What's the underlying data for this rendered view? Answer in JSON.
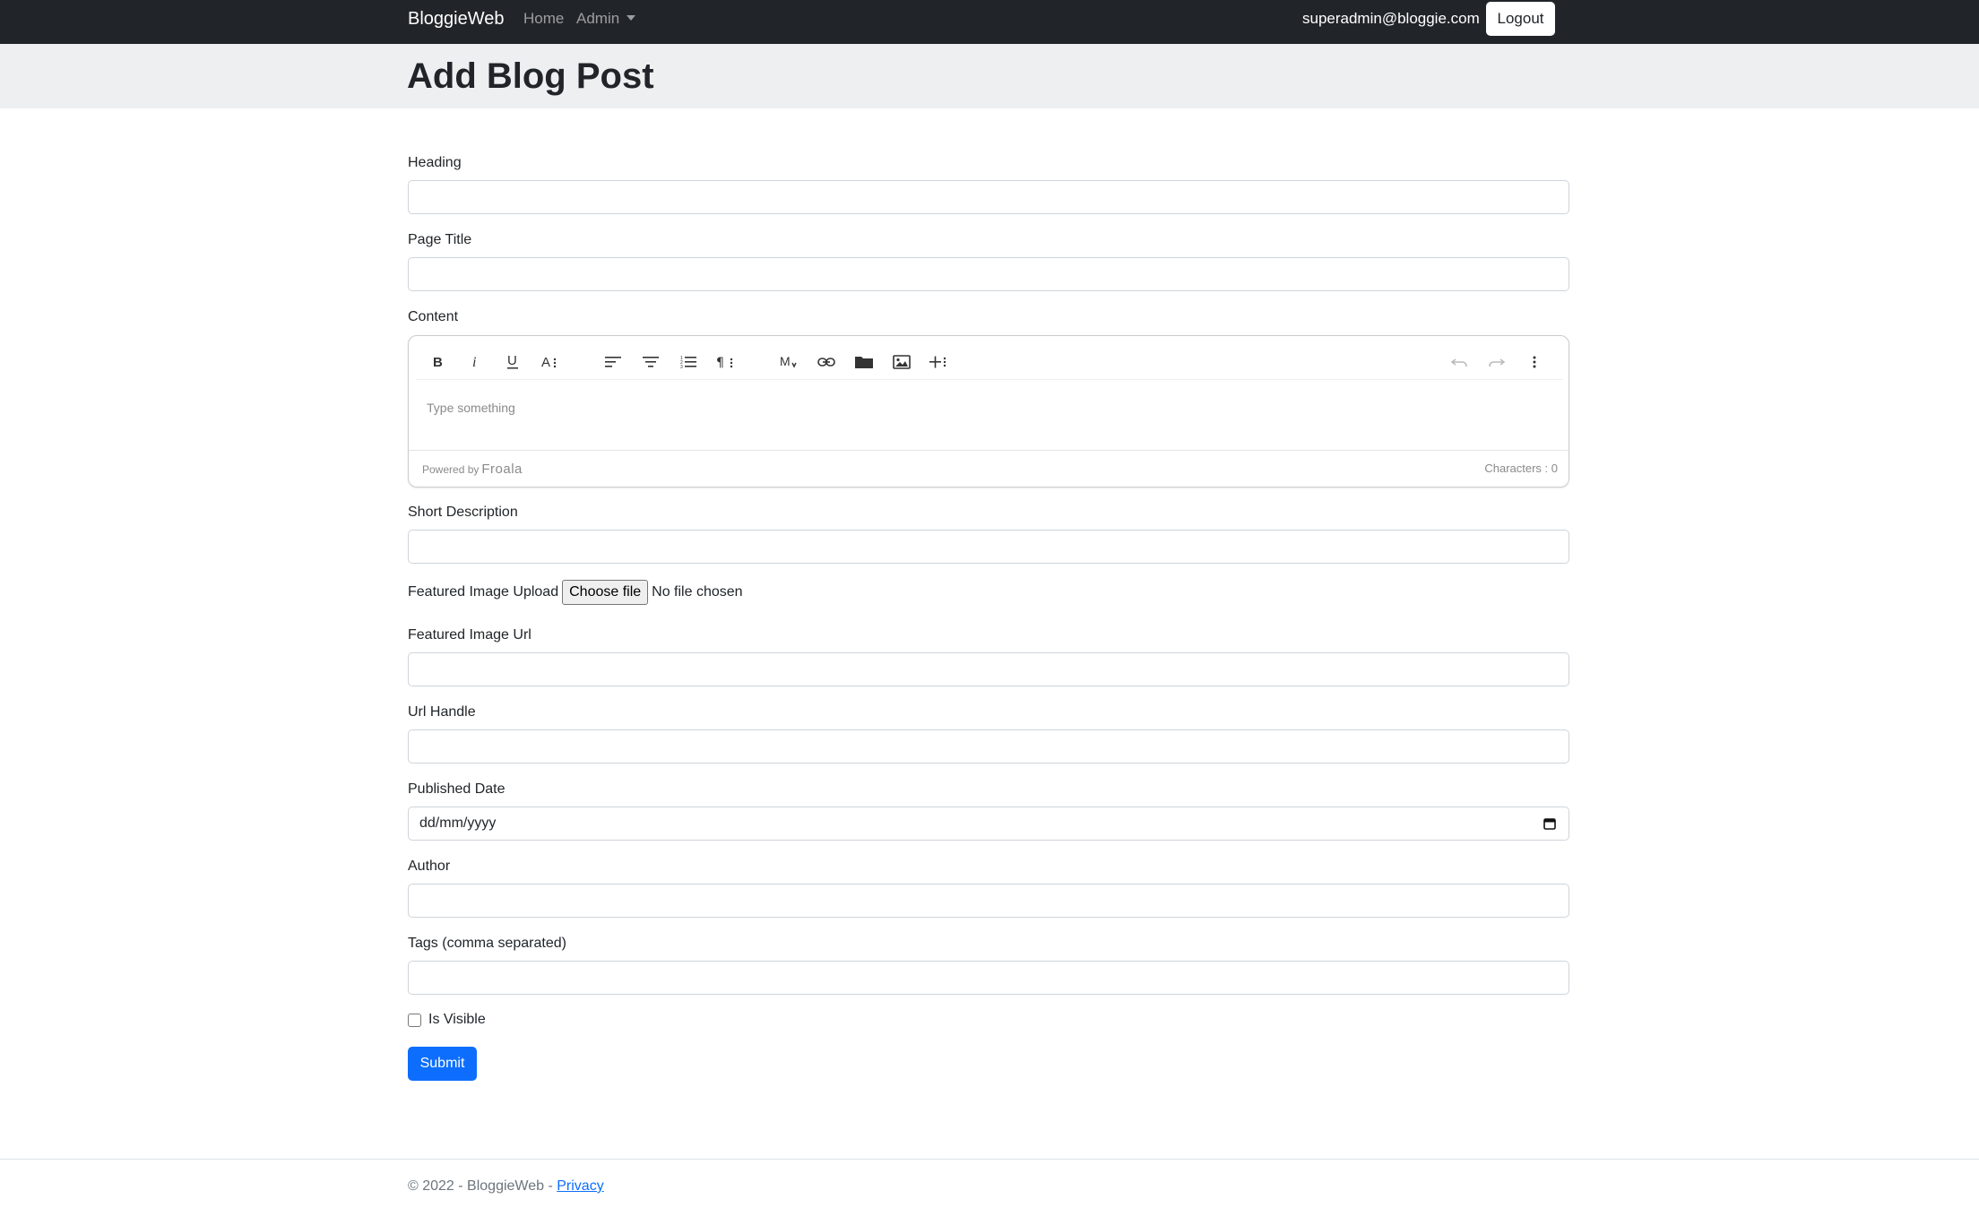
{
  "navbar": {
    "brand": "BloggieWeb",
    "links": [
      {
        "label": "Home"
      },
      {
        "label": "Admin"
      }
    ],
    "user_email": "superadmin@bloggie.com",
    "logout_label": "Logout"
  },
  "header": {
    "title": "Add Blog Post"
  },
  "form": {
    "heading_label": "Heading",
    "heading_value": "",
    "page_title_label": "Page Title",
    "page_title_value": "",
    "content_label": "Content",
    "editor": {
      "placeholder": "Type something",
      "powered_by": "Powered by",
      "powered_brand": "Froala",
      "char_count": "Characters : 0",
      "toolbar_icons": [
        "bold-icon",
        "italic-icon",
        "underline-icon",
        "text-style-icon",
        "align-left-icon",
        "align-center-icon",
        "ordered-list-icon",
        "paragraph-format-icon",
        "markdown-icon",
        "link-icon",
        "folder-icon",
        "image-icon",
        "insert-more-icon",
        "undo-icon",
        "redo-icon",
        "more-options-icon"
      ]
    },
    "short_description_label": "Short Description",
    "short_description_value": "",
    "featured_image_upload_label": "Featured Image Upload",
    "choose_file_label": "Choose file",
    "file_status": "No file chosen",
    "featured_image_url_label": "Featured Image Url",
    "featured_image_url_value": "",
    "url_handle_label": "Url Handle",
    "url_handle_value": "",
    "published_date_label": "Published Date",
    "published_date_placeholder": "dd/mm/yyyy",
    "author_label": "Author",
    "author_value": "",
    "tags_label": "Tags (comma separated)",
    "tags_value": "",
    "is_visible_label": "Is Visible",
    "is_visible_checked": false,
    "submit_label": "Submit"
  },
  "footer": {
    "copyright": "© 2022 - BloggieWeb - ",
    "privacy_label": "Privacy"
  },
  "colors": {
    "navbar_bg": "#212529",
    "header_bg": "#eeeff1",
    "primary": "#0d6efd",
    "input_border": "#ced4da"
  }
}
